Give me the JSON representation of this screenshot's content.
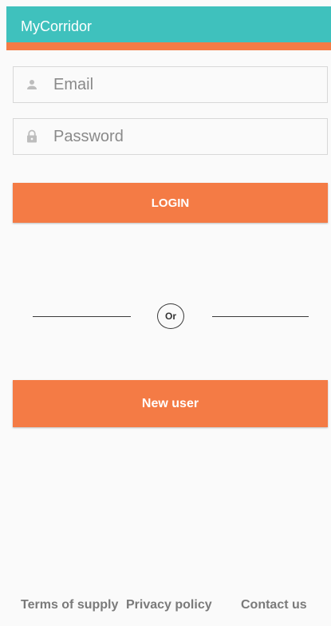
{
  "app": {
    "title": "MyCorridor",
    "colors": {
      "appbar": "#3fc1bd",
      "accent": "#f47b45",
      "background": "#fafafa"
    }
  },
  "login_form": {
    "email": {
      "placeholder": "Email",
      "value": "",
      "icon": "person-icon"
    },
    "password": {
      "placeholder": "Password",
      "value": "",
      "icon": "lock-icon"
    },
    "login_label": "LOGIN"
  },
  "divider": {
    "label": "Or"
  },
  "new_user_label": "New user",
  "footer": {
    "terms_label": "Terms of supply",
    "privacy_label": "Privacy policy",
    "contact_label": "Contact us"
  }
}
